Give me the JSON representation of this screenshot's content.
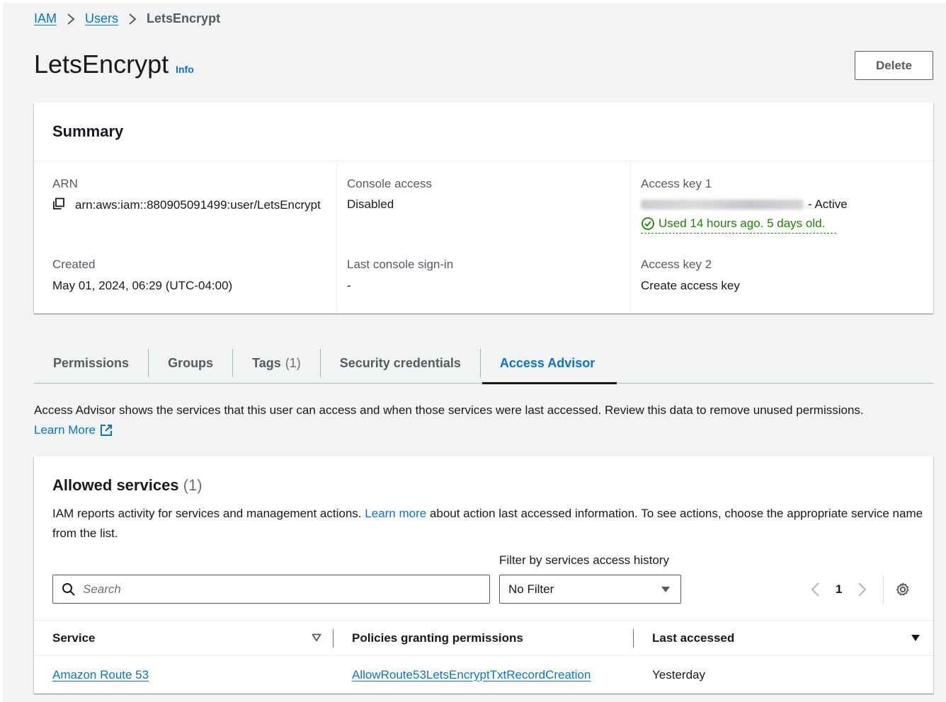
{
  "breadcrumb": {
    "iam": "IAM",
    "users": "Users",
    "current": "LetsEncrypt"
  },
  "header": {
    "title": "LetsEncrypt",
    "info": "Info",
    "delete_label": "Delete"
  },
  "summary": {
    "title": "Summary",
    "arn_label": "ARN",
    "arn_value": "arn:aws:iam::880905091499:user/LetsEncrypt",
    "created_label": "Created",
    "created_value": "May 01, 2024, 06:29 (UTC-04:00)",
    "console_access_label": "Console access",
    "console_access_value": "Disabled",
    "last_signin_label": "Last console sign-in",
    "last_signin_value": "-",
    "access_key1_label": "Access key 1",
    "access_key1_status": "- Active",
    "access_key1_usage": "Used 14 hours ago. 5 days old.",
    "access_key2_label": "Access key 2",
    "create_access_key": "Create access key"
  },
  "tabs": [
    {
      "label": "Permissions",
      "count": ""
    },
    {
      "label": "Groups",
      "count": ""
    },
    {
      "label": "Tags",
      "count": "(1)"
    },
    {
      "label": "Security credentials",
      "count": ""
    },
    {
      "label": "Access Advisor",
      "count": ""
    }
  ],
  "active_tab": "Access Advisor",
  "access_advisor": {
    "description": "Access Advisor shows the services that this user can access and when those services were last accessed. Review this data to remove unused permissions.",
    "learn_more": "Learn More"
  },
  "allowed_services": {
    "title": "Allowed services",
    "count": "(1)",
    "desc_before": "IAM reports activity for services and management actions. ",
    "desc_link": "Learn more",
    "desc_after": " about action last accessed information. To see actions, choose the appropriate service name from the list.",
    "filter_label": "Filter by services access history",
    "search_placeholder": "Search",
    "filter_value": "No Filter",
    "page": "1",
    "columns": {
      "service": "Service",
      "policies": "Policies granting permissions",
      "last_accessed": "Last accessed"
    },
    "rows": [
      {
        "service": "Amazon Route 53",
        "policy": "AllowRoute53LetsEncryptTxtRecordCreation",
        "last_accessed": "Yesterday"
      }
    ]
  },
  "colors": {
    "link": "#0972d3",
    "success": "#1d8102",
    "text": "#16191f",
    "muted": "#545b64"
  },
  "icons": [
    "chevron-right-icon",
    "copy-icon",
    "check-circle-icon",
    "external-link-icon",
    "search-icon",
    "caret-down-icon",
    "chevron-left-icon",
    "settings-gear-icon",
    "sort-icon"
  ]
}
